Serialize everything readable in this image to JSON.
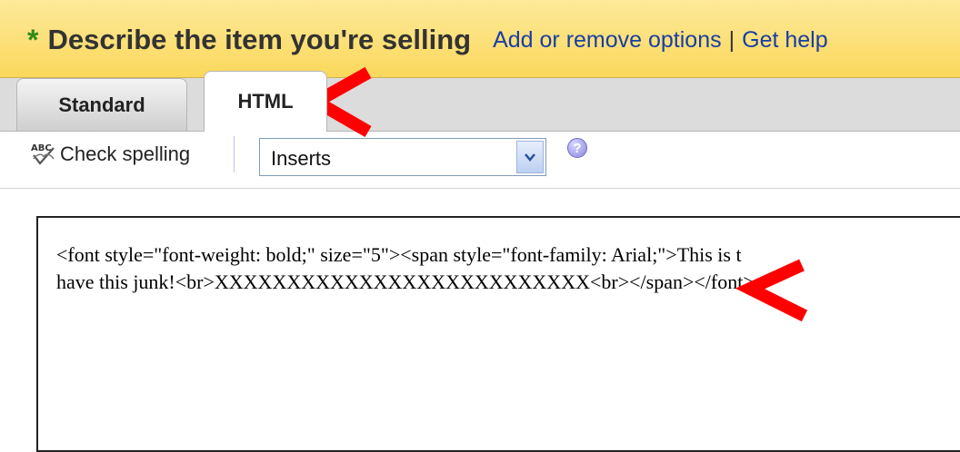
{
  "header": {
    "required_marker": "*",
    "title": "Describe the item you're selling",
    "links": [
      {
        "label": "Add or remove options"
      },
      {
        "label": "Get help"
      }
    ],
    "separator": "|"
  },
  "tabs": [
    {
      "label": "Standard",
      "active": false
    },
    {
      "label": "HTML",
      "active": true
    }
  ],
  "toolbar": {
    "spellcheck_label": "Check spelling",
    "spellcheck_icon": "abc-spellcheck-icon",
    "inserts_select": {
      "value": "Inserts"
    },
    "help_icon": "question-icon",
    "help_glyph": "?"
  },
  "editor": {
    "lines": [
      "<font style=\"font-weight: bold;\" size=\"5\"><span style=\"font-family: Arial;\">This is t",
      "have this junk!<br>XXXXXXXXXXXXXXXXXXXXXXXXXX<br></span></font>"
    ]
  },
  "colors": {
    "header_bg": "#fbd85c",
    "star": "#2e8b17",
    "link": "#1a3ea3",
    "annotation": "#ff0000"
  }
}
